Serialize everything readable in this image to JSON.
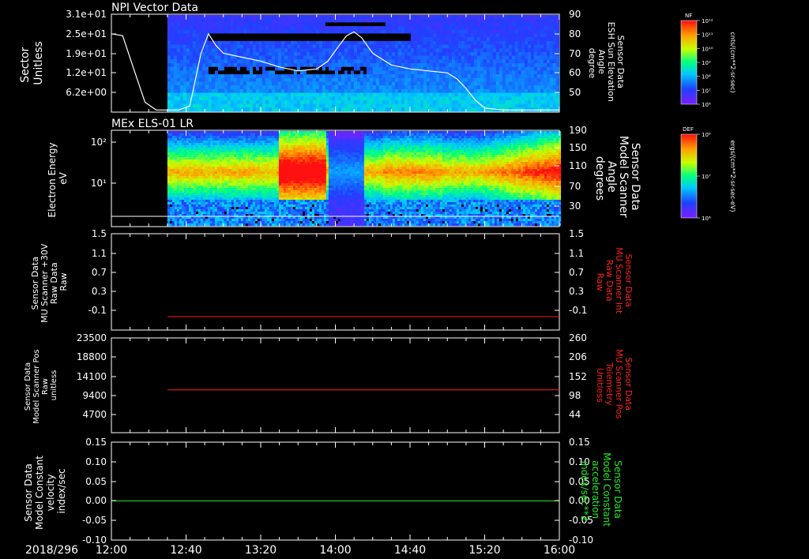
{
  "date_label": "2018/296",
  "time_ticks": [
    "12:00",
    "12:40",
    "13:20",
    "14:00",
    "14:40",
    "15:20",
    "16:00"
  ],
  "colorbars": [
    {
      "name": "NF",
      "unit": "cnts/(cm**2-sr-sec)",
      "ticks": [
        "10¹²",
        "10¹¹",
        "10¹⁰",
        "10⁹",
        "10⁸",
        "10⁷",
        "10⁶"
      ]
    },
    {
      "name": "DEF",
      "unit": "ergs/(cm**2-sr-sec-eV)",
      "ticks": [
        "10⁸",
        "10⁷",
        "10⁶"
      ]
    }
  ],
  "panels": [
    {
      "title": "NPI Vector Data",
      "left_label": [
        "Sector",
        "Unitless"
      ],
      "left_ticks": [
        "3.1e+01",
        "2.5e+01",
        "1.9e+01",
        "1.2e+01",
        "6.2e+00"
      ],
      "right_label": [
        "Sensor Data",
        "ESH Sun Elevation",
        "Angle",
        "degree"
      ],
      "right_ticks": [
        "90",
        "80",
        "70",
        "60",
        "50"
      ],
      "right_color": "#ffffff"
    },
    {
      "title": "MEx ELS-01 LR",
      "left_label": [
        "Electron Energy",
        "eV"
      ],
      "left_ticks": [
        "10²",
        "10¹"
      ],
      "right_label": [
        "Sensor Data",
        "Model Scanner",
        "Angle",
        "degrees"
      ],
      "right_ticks": [
        "190",
        "150",
        "110",
        "70",
        "30"
      ],
      "right_color": "#ffffff"
    },
    {
      "title": "",
      "left_label": [
        "Sensor Data",
        "MU Scanner +30V",
        "Raw Data",
        "Raw"
      ],
      "left_ticks": [
        "1.5",
        "1.1",
        "0.7",
        "0.3",
        "-0.1"
      ],
      "right_label": [
        "Sensor Data",
        "MU Scanner Int",
        "Raw Data",
        "Raw"
      ],
      "right_ticks": [
        "1.5",
        "1.1",
        "0.7",
        "0.3",
        "-0.1"
      ],
      "right_color": "#ff2020"
    },
    {
      "title": "",
      "left_label": [
        "Sensor Data",
        "Model Scanner Pos",
        "Raw",
        "unitless"
      ],
      "left_ticks": [
        "23500",
        "18800",
        "14100",
        "9400",
        "4700"
      ],
      "right_label": [
        "Sensor Data",
        "MU Scanner Pos",
        "Telemetry",
        "Unitless"
      ],
      "right_ticks": [
        "260",
        "206",
        "152",
        "98",
        "44"
      ],
      "right_color": "#ff2020"
    },
    {
      "title": "",
      "left_label": [
        "Sensor Data",
        "Model Constant",
        "velocity",
        "index/sec"
      ],
      "left_ticks": [
        "0.15",
        "0.10",
        "0.05",
        "0.00",
        "-0.05",
        "-0.10"
      ],
      "right_label": [
        "Sensor Data",
        "Model Constant",
        "acceleration",
        "index/sec**2"
      ],
      "right_ticks": [
        "0.15",
        "0.10",
        "0.05",
        "0.00",
        "-0.05",
        "-0.10"
      ],
      "right_color": "#22ee22"
    }
  ],
  "chart_data": [
    {
      "type": "heatmap",
      "title": "NPI Vector Data",
      "ylabel": "Sector Unitless",
      "x_range": [
        "12:00",
        "16:00"
      ],
      "data_start": "12:30",
      "y_range": [
        0,
        32
      ],
      "overlay_series": {
        "name": "Sensor Data ESH Sun Elevation Angle",
        "unit": "degree",
        "y_range": [
          40,
          90
        ],
        "x": [
          "12:00",
          "12:06",
          "12:12",
          "12:18",
          "12:24",
          "12:30",
          "12:36",
          "12:42",
          "12:48",
          "12:52",
          "12:56",
          "13:00",
          "13:10",
          "13:20",
          "13:30",
          "13:40",
          "13:50",
          "13:56",
          "14:02",
          "14:06",
          "14:10",
          "14:14",
          "14:20",
          "14:30",
          "14:40",
          "14:50",
          "15:00",
          "15:05",
          "15:10",
          "15:15",
          "15:20",
          "15:30",
          "15:40",
          "16:00"
        ],
        "values": [
          80,
          79,
          62,
          45,
          41,
          41,
          41,
          43,
          70,
          80,
          74,
          70,
          68,
          66,
          63,
          61,
          62,
          66,
          74,
          79,
          81,
          78,
          70,
          64,
          62,
          61,
          60,
          57,
          52,
          46,
          42,
          41,
          41,
          41
        ]
      }
    },
    {
      "type": "heatmap",
      "title": "MEx ELS-01 LR",
      "ylabel": "Electron Energy eV",
      "x_range": [
        "12:00",
        "16:00"
      ],
      "data_start": "12:30",
      "y_scale": "log",
      "y_range": [
        1,
        200
      ],
      "overlay_series": {
        "name": "Sensor Data Model Scanner Angle",
        "unit": "degrees",
        "y_range": [
          10,
          190
        ],
        "x": [
          "12:00",
          "16:00"
        ],
        "values": [
          12,
          12
        ]
      }
    },
    {
      "type": "line",
      "ylabel": "Sensor Data MU Scanner +30V Raw Data Raw",
      "y_range": [
        -0.3,
        1.5
      ],
      "series": [
        {
          "name": "Sensor Data MU Scanner Int Raw Data Raw",
          "x": [
            "12:30",
            "16:00"
          ],
          "values": [
            -0.05,
            -0.05
          ],
          "color": "#ff2020"
        }
      ]
    },
    {
      "type": "line",
      "ylabel": "Sensor Data Model Scanner Pos Raw unitless",
      "y_range": [
        0,
        23500
      ],
      "series": [
        {
          "name": "Sensor Data MU Scanner Pos Telemetry Unitless",
          "x": [
            "12:30",
            "16:00"
          ],
          "values": [
            112,
            112
          ],
          "color": "#ff2020"
        }
      ]
    },
    {
      "type": "line",
      "ylabel": "Sensor Data Model Constant velocity index/sec",
      "y_range": [
        -0.1,
        0.15
      ],
      "series": [
        {
          "name": "Sensor Data Model Constant acceleration index/sec**2",
          "x": [
            "12:00",
            "16:00"
          ],
          "values": [
            0.0,
            0.0
          ],
          "color": "#22ee22"
        }
      ]
    }
  ]
}
